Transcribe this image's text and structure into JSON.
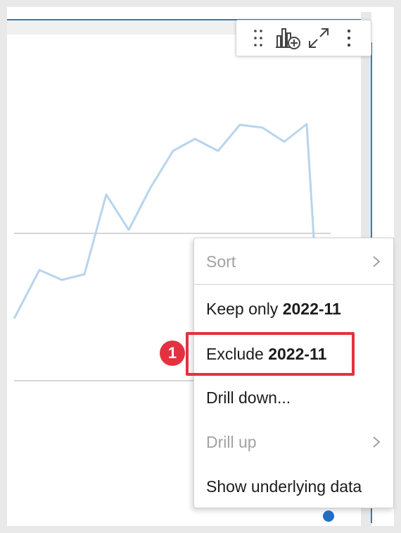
{
  "chart_data": {
    "type": "line",
    "series_color": "#b8d4ee",
    "points": [
      [
        20,
        452
      ],
      [
        56,
        383
      ],
      [
        88,
        397
      ],
      [
        120,
        389
      ],
      [
        151,
        276
      ],
      [
        183,
        326
      ],
      [
        214,
        266
      ],
      [
        246,
        214
      ],
      [
        277,
        197
      ],
      [
        310,
        214
      ],
      [
        341,
        177
      ],
      [
        373,
        181
      ],
      [
        404,
        201
      ],
      [
        436,
        176
      ],
      [
        446,
        337
      ]
    ],
    "gridlines": [
      331,
      540
    ]
  },
  "toolbar": {
    "icons": [
      "drag-handle-icon",
      "add-chart-icon",
      "expand-icon",
      "more-options-icon"
    ]
  },
  "menu": {
    "sort_label": "Sort",
    "keep_only_prefix": "Keep only ",
    "keep_only_value": "2022-11",
    "exclude_prefix": "Exclude ",
    "exclude_value": "2022-11",
    "drill_down_label": "Drill down...",
    "drill_up_label": "Drill up",
    "show_data_label": "Show underlying data"
  },
  "annotation": {
    "step_number": "1",
    "highlight_color": "#e3323f"
  },
  "colors": {
    "accent": "#2b7fc0",
    "disabled_text": "#a2a2a2"
  }
}
